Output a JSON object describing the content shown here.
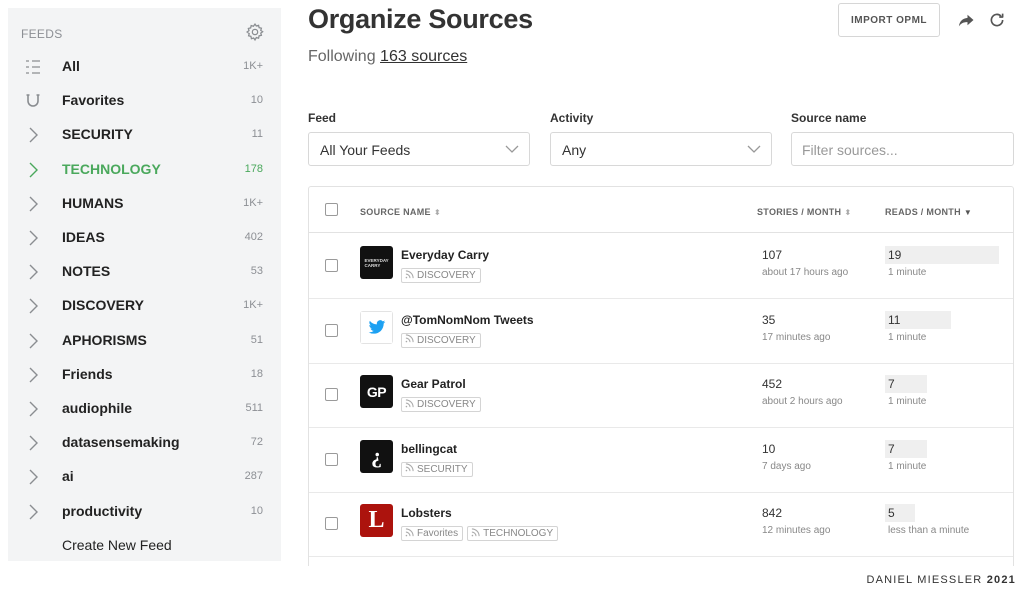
{
  "sidebar": {
    "header": "FEEDS",
    "items": [
      {
        "name": "All",
        "count": "1K+",
        "icon": "list-icon"
      },
      {
        "name": "Favorites",
        "count": "10",
        "icon": "horseshoe-icon"
      },
      {
        "name": "SECURITY",
        "count": "11",
        "icon": "chevron-right-icon"
      },
      {
        "name": "TECHNOLOGY",
        "count": "178",
        "icon": "chevron-right-icon",
        "active": true
      },
      {
        "name": "HUMANS",
        "count": "1K+",
        "icon": "chevron-right-icon"
      },
      {
        "name": "IDEAS",
        "count": "402",
        "icon": "chevron-right-icon"
      },
      {
        "name": "NOTES",
        "count": "53",
        "icon": "chevron-right-icon"
      },
      {
        "name": "DISCOVERY",
        "count": "1K+",
        "icon": "chevron-right-icon"
      },
      {
        "name": "APHORISMS",
        "count": "51",
        "icon": "chevron-right-icon"
      },
      {
        "name": "Friends",
        "count": "18",
        "icon": "chevron-right-icon"
      },
      {
        "name": "audiophile",
        "count": "511",
        "icon": "chevron-right-icon"
      },
      {
        "name": "datasensemaking",
        "count": "72",
        "icon": "chevron-right-icon"
      },
      {
        "name": "ai",
        "count": "287",
        "icon": "chevron-right-icon"
      },
      {
        "name": "productivity",
        "count": "10",
        "icon": "chevron-right-icon"
      }
    ],
    "create_label": "Create New Feed"
  },
  "main": {
    "title": "Organize Sources",
    "following_prefix": "Following",
    "following_link": "163 sources",
    "import_label": "IMPORT OPML",
    "filters": {
      "feed_label": "Feed",
      "feed_value": "All Your Feeds",
      "activity_label": "Activity",
      "activity_value": "Any",
      "source_label": "Source name",
      "source_placeholder": "Filter sources..."
    },
    "table": {
      "col_source": "SOURCE NAME",
      "col_stories": "STORIES / MONTH",
      "col_reads": "READS / MONTH",
      "rows": [
        {
          "name": "Everyday Carry",
          "tags": [
            "DISCOVERY"
          ],
          "stories": "107",
          "stories_sub": "about 17 hours ago",
          "reads": "19",
          "reads_sub": "1 minute",
          "reads_level": 0.19,
          "logo": "everyday-carry-logo",
          "logo_text": "EVERYDAY CARRY"
        },
        {
          "name": "@TomNomNom Tweets",
          "tags": [
            "DISCOVERY"
          ],
          "stories": "35",
          "stories_sub": "17 minutes ago",
          "reads": "11",
          "reads_sub": "1 minute",
          "reads_level": 0.11,
          "logo": "twitter-bird-logo",
          "logo_text": ""
        },
        {
          "name": "Gear Patrol",
          "tags": [
            "DISCOVERY"
          ],
          "stories": "452",
          "stories_sub": "about 2 hours ago",
          "reads": "7",
          "reads_sub": "1 minute",
          "reads_level": 0.07,
          "logo": "gear-patrol-logo",
          "logo_text": "GP"
        },
        {
          "name": "bellingcat",
          "tags": [
            "SECURITY"
          ],
          "stories": "10",
          "stories_sub": "7 days ago",
          "reads": "7",
          "reads_sub": "1 minute",
          "reads_level": 0.07,
          "logo": "bellingcat-logo",
          "logo_text": "¿"
        },
        {
          "name": "Lobsters",
          "tags": [
            "Favorites",
            "TECHNOLOGY"
          ],
          "stories": "842",
          "stories_sub": "12 minutes ago",
          "reads": "5",
          "reads_sub": "less than a minute",
          "reads_level": 0.05,
          "logo": "lobsters-logo",
          "logo_text": "L"
        }
      ]
    }
  },
  "credit": {
    "name": "DANIEL MIESSLER",
    "year": "2021"
  },
  "colors": {
    "accent_green": "#4aa85c",
    "twitter_blue": "#1da1f2",
    "lobsters_red": "#ac130d"
  }
}
